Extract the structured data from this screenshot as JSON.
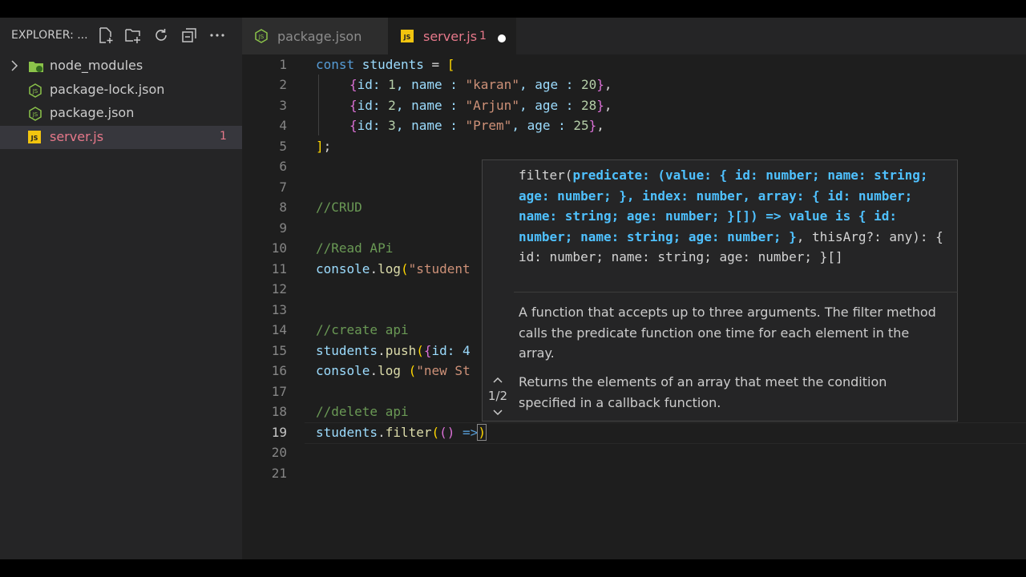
{
  "sidebar": {
    "title": "EXPLORER: ...",
    "toolbar_icons": [
      "new-file-icon",
      "new-folder-icon",
      "refresh-icon",
      "collapse-all-icon",
      "more-icon"
    ],
    "items": [
      {
        "label": "node_modules",
        "type": "folder"
      },
      {
        "label": "package-lock.json",
        "type": "json"
      },
      {
        "label": "package.json",
        "type": "json"
      },
      {
        "label": "server.js",
        "type": "js",
        "badge": "1",
        "selected": true
      }
    ]
  },
  "tabs": [
    {
      "label": "package.json",
      "active": false
    },
    {
      "label": "server.js",
      "active": true,
      "problems": "1",
      "modified": true
    }
  ],
  "editor": {
    "line_numbers": [
      "1",
      "2",
      "3",
      "4",
      "5",
      "6",
      "7",
      "8",
      "9",
      "10",
      "11",
      "12",
      "13",
      "14",
      "15",
      "16",
      "17",
      "18",
      "19",
      "20",
      "21"
    ],
    "active_line": "19",
    "lines": {
      "l1": {
        "kw": "const",
        "var": " students",
        "rest": " = ",
        "br": "["
      },
      "l2": {
        "a": "{",
        "b": "id: ",
        "c": "1",
        "d": ", name : ",
        "e": "\"karan\"",
        "f": ", age : ",
        "g": "20",
        "h": "}",
        "i": ","
      },
      "l3": {
        "a": "{",
        "b": "id: ",
        "c": "2",
        "d": ", name : ",
        "e": "\"Arjun\"",
        "f": ", age : ",
        "g": "28",
        "h": "}",
        "i": ","
      },
      "l4": {
        "a": "{",
        "b": "id: ",
        "c": "3",
        "d": ", name : ",
        "e": "\"Prem\"",
        "f": ", age : ",
        "g": "25",
        "h": "}",
        "i": ","
      },
      "l5": {
        "br": "]",
        "rest": ";"
      },
      "l8": "//CRUD",
      "l10": "//Read APi",
      "l11": {
        "var": "console",
        "dot": ".",
        "fn": "log",
        "br": "(",
        "str": "\"student"
      },
      "l14": "//create api",
      "l15": {
        "var": "students",
        "dot": ".",
        "fn": "push",
        "br": "(",
        "br2": "{",
        "rest": "id: 4"
      },
      "l16": {
        "var": "console",
        "dot": ".",
        "fn": "log",
        "sp": " ",
        "br": "(",
        "str": "\"new St"
      },
      "l18": "//delete api",
      "l19": {
        "var": "students",
        "dot": ".",
        "fn": "filter",
        "br": "(",
        "br2": "(",
        "br3": ")",
        "arrow": " =>",
        "close": ")"
      }
    }
  },
  "hover": {
    "signature": {
      "s1": "filter(",
      "s2": "predicate: (value: { id: number; name: string; age: number; }, index: number, array: { id: number; name: string; age: number; }[]) => value is { id: number; name: string; age: number; }",
      "s3": ", thisArg?: any): { id: number; name: string; age: number; }[]"
    },
    "doc1": "A function that accepts up to three arguments. The filter method calls the predicate function one time for each element in the array.",
    "doc2": "Returns the elements of an array that meet the condition specified in a callback function.",
    "overload": "1/2"
  }
}
